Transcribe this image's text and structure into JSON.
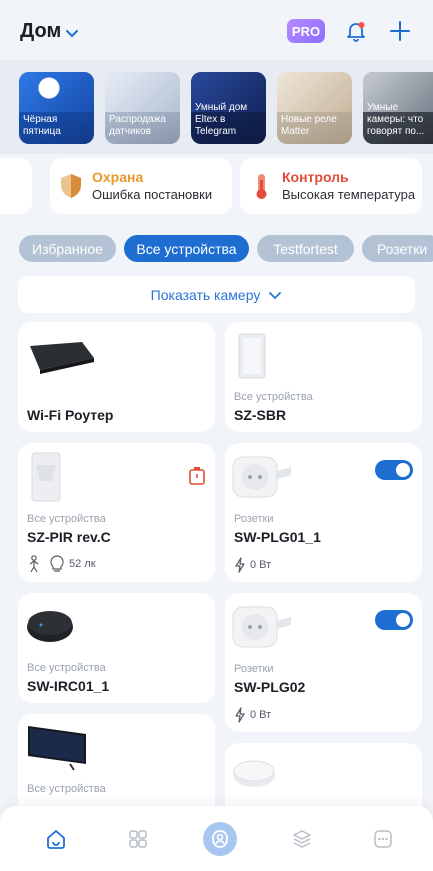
{
  "header": {
    "title": "Дом",
    "pro_label": "PRO"
  },
  "stories": [
    {
      "label": "Чёрная пятница"
    },
    {
      "label": "Распродажа датчиков"
    },
    {
      "label": "Умный дом Eltex в Telegram"
    },
    {
      "label": "Новые реле Matter"
    },
    {
      "label": "Умные камеры: что говорят по..."
    }
  ],
  "events": [
    {
      "title": "Охрана",
      "subtitle": "Ошибка постановки",
      "color": "#e79a2b"
    },
    {
      "title": "Контроль",
      "subtitle": "Высокая температура",
      "color": "#e14d3a"
    }
  ],
  "chips": [
    {
      "label": "Избранное"
    },
    {
      "label": "Все устройства"
    },
    {
      "label": "Testfortest"
    },
    {
      "label": "Розетки"
    }
  ],
  "camera_button": {
    "label": "Показать камеру"
  },
  "devices": [
    {
      "name": "Wi-Fi Роутер",
      "room": ""
    },
    {
      "name": "SZ-SBR",
      "room": "Все устройства"
    },
    {
      "name": "SZ-PIR rev.C",
      "room": "Все устройства",
      "lux": "52 лк"
    },
    {
      "name": "SW-PLG01_1",
      "room": "Розетки",
      "power": "0 Вт"
    },
    {
      "name": "SW-IRC01_1",
      "room": "Все устройства"
    },
    {
      "name": "SW-PLG02",
      "room": "Розетки",
      "power": "0 Вт"
    },
    {
      "name": "",
      "room": "Все устройства"
    },
    {
      "name": "",
      "room": ""
    }
  ],
  "colors": {
    "accent": "#1e6ed1",
    "chip_inactive": "#b4c2d6",
    "background": "#f1f4f9"
  }
}
